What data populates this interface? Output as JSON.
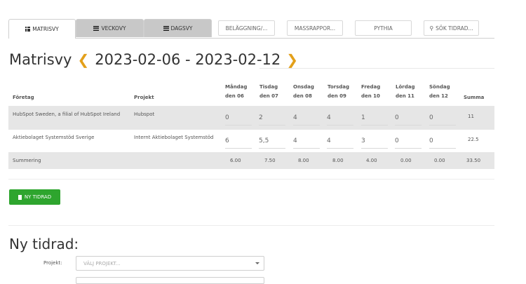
{
  "tabs": [
    {
      "label": "MATRISVY",
      "icon": "grid-icon"
    },
    {
      "label": "VECKOVY",
      "icon": "list-icon"
    },
    {
      "label": "DAGSVY",
      "icon": "bars-icon"
    },
    {
      "label": "BELÄGGNING/..."
    },
    {
      "label": "MASSRAPPOR..."
    },
    {
      "label": "PYTHIA"
    },
    {
      "label": "SÖK TIDRAD...",
      "icon": "search-icon"
    }
  ],
  "header": {
    "view": "Matrisvy",
    "range": "2023-02-06 - 2023-02-12",
    "prev_icon": "chevron-left-icon",
    "next_icon": "chevron-right-icon"
  },
  "table": {
    "headers": {
      "company": "Företag",
      "project": "Projekt",
      "days": [
        {
          "day": "Måndag",
          "date": "den 06"
        },
        {
          "day": "Tisdag",
          "date": "den 07"
        },
        {
          "day": "Onsdag",
          "date": "den 08"
        },
        {
          "day": "Torsdag",
          "date": "den 09"
        },
        {
          "day": "Fredag",
          "date": "den 10"
        },
        {
          "day": "Lördag",
          "date": "den 11"
        },
        {
          "day": "Söndag",
          "date": "den 12"
        }
      ],
      "sum": "Summa"
    },
    "rows": [
      {
        "company": "HubSpot Sweden, a filial of HubSpot Ireland",
        "project": "Hubspot",
        "values": [
          "0",
          "2",
          "4",
          "4",
          "1",
          "0",
          "0"
        ],
        "sum": "11"
      },
      {
        "company": "Aktiebolaget Systemstöd Sverige",
        "project": "Internt Aktiebolaget Systemstöd",
        "values": [
          "6",
          "5,5",
          "4",
          "4",
          "3",
          "0",
          "0"
        ],
        "sum": "22.5"
      }
    ],
    "summary": {
      "label": "Summering",
      "values": [
        "6.00",
        "7.50",
        "8.00",
        "8.00",
        "4.00",
        "0.00",
        "0.00"
      ],
      "total": "33.50"
    }
  },
  "actions": {
    "new_row": "NY TIDRAD"
  },
  "new_row_form": {
    "title": "Ny tidrad:",
    "project_label": "Projekt:",
    "project_placeholder": "VÄLJ PROJEKT..."
  }
}
